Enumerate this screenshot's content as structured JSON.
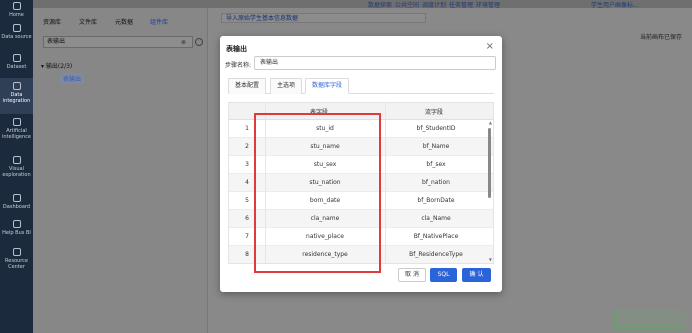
{
  "nav": [
    {
      "label": "Home",
      "icon": "home-icon"
    },
    {
      "label": "Data source",
      "icon": "database-icon"
    },
    {
      "label": "Dataset",
      "icon": "dataset-icon"
    },
    {
      "label": "Data integration",
      "icon": "integration-icon"
    },
    {
      "label": "Artificial intelligence",
      "icon": "ai-icon"
    },
    {
      "label": "Visual exploration",
      "icon": "chart-icon"
    },
    {
      "label": "Dashboard",
      "icon": "dashboard-icon"
    },
    {
      "label": "Help Bus BI",
      "icon": "help-icon"
    },
    {
      "label": "Resource Center",
      "icon": "resource-icon"
    }
  ],
  "top_links": [
    "数据探索",
    "公共空间",
    "调度计划",
    "任务管理",
    "环境管理",
    "学生用户画像标..."
  ],
  "left_panel": {
    "tabs": [
      "资源库",
      "文件库",
      "元数据",
      "组件库"
    ],
    "active_tab": "组件库",
    "search_value": "表输出",
    "tree_root": "输出(2/3)",
    "tree_child": "表输出"
  },
  "workspace": {
    "tab_title": "导入原始学生基本信息数据",
    "save_note": "当前画布已保存"
  },
  "modal": {
    "title": "表输出",
    "step_label": "步骤名称:",
    "step_value": "表输出",
    "tabs": [
      "基本配置",
      "主选项",
      "数据库字段"
    ],
    "active_tab": "数据库字段",
    "columns": [
      "表字段",
      "流字段"
    ],
    "rows": [
      {
        "idx": "1",
        "table_field": "stu_id",
        "stream_field": "bf_StudentID"
      },
      {
        "idx": "2",
        "table_field": "stu_name",
        "stream_field": "bf_Name"
      },
      {
        "idx": "3",
        "table_field": "stu_sex",
        "stream_field": "bf_sex"
      },
      {
        "idx": "4",
        "table_field": "stu_nation",
        "stream_field": "bf_nation"
      },
      {
        "idx": "5",
        "table_field": "born_date",
        "stream_field": "bf_BornDate"
      },
      {
        "idx": "6",
        "table_field": "cla_name",
        "stream_field": "cla_Name"
      },
      {
        "idx": "7",
        "table_field": "native_place",
        "stream_field": "Bf_NativePlace"
      },
      {
        "idx": "8",
        "table_field": "residence_type",
        "stream_field": "Bf_ResidenceType"
      }
    ],
    "buttons": {
      "cancel": "取 消",
      "sql": "SQL",
      "ok": "确 认"
    }
  },
  "colors": {
    "accent": "#2b63d9",
    "highlight": "#e23a3a",
    "nav_bg": "#1c2a3e"
  }
}
